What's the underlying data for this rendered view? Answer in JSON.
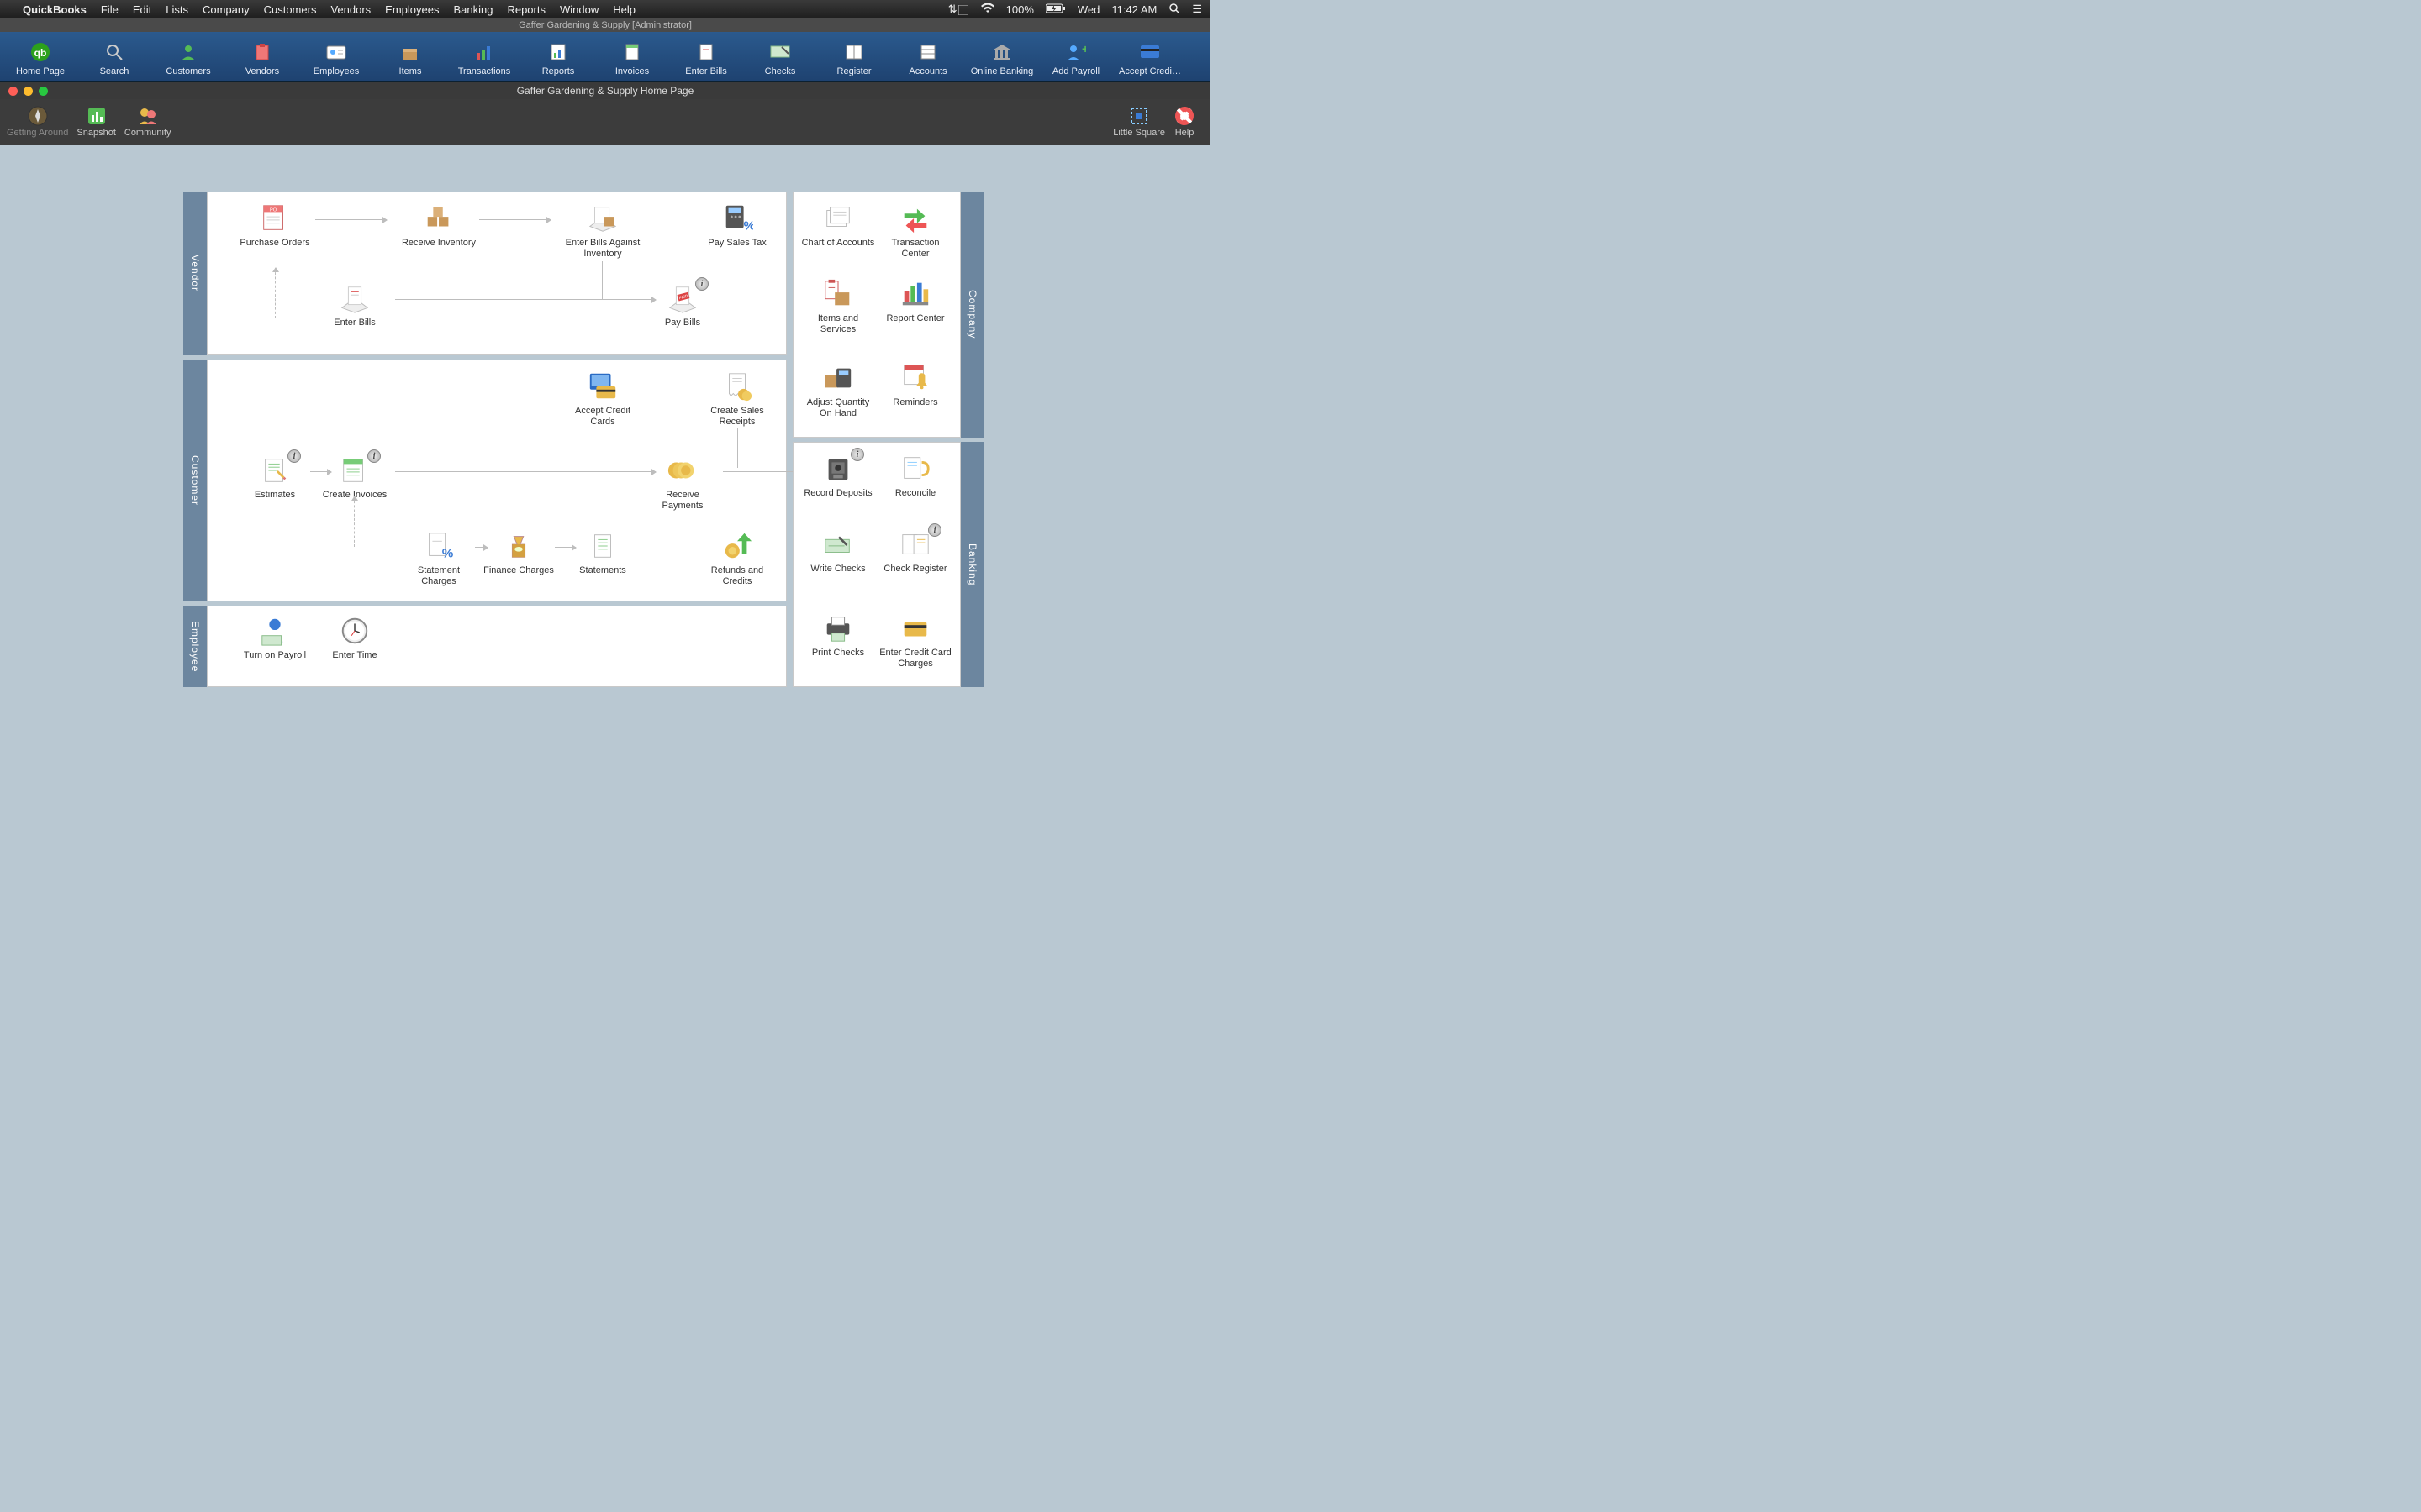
{
  "menubar": {
    "app": "QuickBooks",
    "items": [
      "File",
      "Edit",
      "Lists",
      "Company",
      "Customers",
      "Vendors",
      "Employees",
      "Banking",
      "Reports",
      "Window",
      "Help"
    ],
    "right": {
      "battery": "100%",
      "day": "Wed",
      "time": "11:42 AM"
    }
  },
  "winbar": {
    "title": "Gaffer Gardening & Supply [Administrator]"
  },
  "maintool": {
    "items": [
      {
        "label": "Home Page",
        "icon": "qb"
      },
      {
        "label": "Search",
        "icon": "search"
      },
      {
        "label": "Customers",
        "icon": "person-green"
      },
      {
        "label": "Vendors",
        "icon": "clipboard"
      },
      {
        "label": "Employees",
        "icon": "idcard"
      },
      {
        "label": "Items",
        "icon": "box"
      },
      {
        "label": "Transactions",
        "icon": "bars"
      },
      {
        "label": "Reports",
        "icon": "report"
      },
      {
        "label": "Invoices",
        "icon": "invoice"
      },
      {
        "label": "Enter Bills",
        "icon": "bill"
      },
      {
        "label": "Checks",
        "icon": "check"
      },
      {
        "label": "Register",
        "icon": "register"
      },
      {
        "label": "Accounts",
        "icon": "ledger"
      },
      {
        "label": "Online Banking",
        "icon": "bank"
      },
      {
        "label": "Add Payroll",
        "icon": "person-plus"
      },
      {
        "label": "Accept Credi…",
        "icon": "card"
      }
    ]
  },
  "subwin": {
    "title": "Gaffer Gardening & Supply Home Page",
    "tools_left": [
      {
        "label": "Getting Around",
        "icon": "compass",
        "disabled": true
      },
      {
        "label": "Snapshot",
        "icon": "snapshot"
      },
      {
        "label": "Community",
        "icon": "community"
      }
    ],
    "tools_right": [
      {
        "label": "Little Square",
        "icon": "square"
      },
      {
        "label": "Help",
        "icon": "help"
      }
    ]
  },
  "sections": {
    "vendor": "Vendor",
    "customer": "Customer",
    "employee": "Employee",
    "company": "Company",
    "banking": "Banking"
  },
  "nodes": {
    "purchase_orders": "Purchase Orders",
    "receive_inventory": "Receive Inventory",
    "enter_bills_inventory": "Enter Bills Against Inventory",
    "pay_sales_tax": "Pay Sales Tax",
    "enter_bills": "Enter Bills",
    "pay_bills": "Pay Bills",
    "accept_cc": "Accept Credit Cards",
    "create_sr": "Create Sales Receipts",
    "estimates": "Estimates",
    "create_invoices": "Create Invoices",
    "receive_payments": "Receive Payments",
    "statement_charges": "Statement Charges",
    "finance_charges": "Finance Charges",
    "statements": "Statements",
    "refunds": "Refunds and Credits",
    "turn_on_payroll": "Turn on Payroll",
    "enter_time": "Enter Time",
    "chart_accounts": "Chart of Accounts",
    "txn_center": "Transaction Center",
    "items_services": "Items and Services",
    "report_center": "Report Center",
    "adjust_qty": "Adjust Quantity On Hand",
    "reminders": "Reminders",
    "record_deposits": "Record Deposits",
    "reconcile": "Reconcile",
    "write_checks": "Write Checks",
    "check_register": "Check Register",
    "print_checks": "Print Checks",
    "enter_cc": "Enter Credit Card Charges"
  }
}
